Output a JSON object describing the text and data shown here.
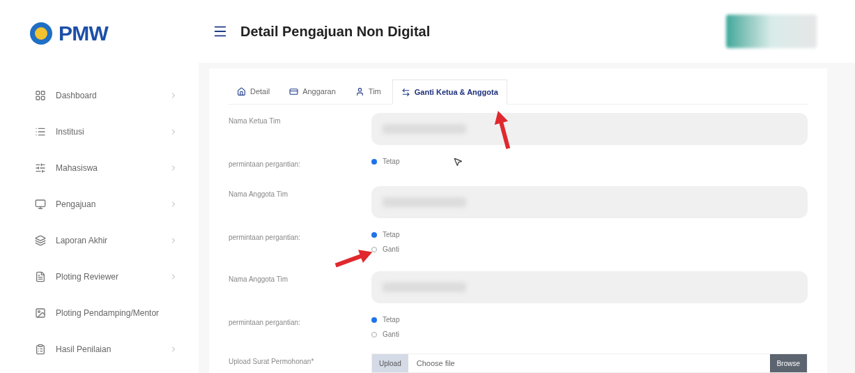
{
  "brand": {
    "text": "PMW"
  },
  "header": {
    "title": "Detail Pengajuan Non Digital"
  },
  "sidebar": {
    "items": [
      {
        "label": "Dashboard",
        "has_arrow": true
      },
      {
        "label": "Institusi",
        "has_arrow": true
      },
      {
        "label": "Mahasiswa",
        "has_arrow": true
      },
      {
        "label": "Pengajuan",
        "has_arrow": true
      },
      {
        "label": "Laporan Akhir",
        "has_arrow": true
      },
      {
        "label": "Ploting Reviewer",
        "has_arrow": true
      },
      {
        "label": "Ploting Pendamping/Mentor",
        "has_arrow": false
      },
      {
        "label": "Hasil Penilaian",
        "has_arrow": true
      }
    ]
  },
  "tabs": [
    {
      "label": "Detail",
      "selected": false
    },
    {
      "label": "Anggaran",
      "selected": false
    },
    {
      "label": "Tim",
      "selected": false
    },
    {
      "label": "Ganti Ketua & Anggota",
      "selected": true
    }
  ],
  "form": [
    {
      "kind": "field",
      "label": "Nama Ketua Tim"
    },
    {
      "kind": "radio",
      "label": "permintaan pergantian:",
      "options": [
        {
          "label": "Tetap",
          "selected": true
        }
      ]
    },
    {
      "kind": "field",
      "label": "Nama Anggota Tim"
    },
    {
      "kind": "radio",
      "label": "permintaan pergantian:",
      "options": [
        {
          "label": "Tetap",
          "selected": true
        },
        {
          "label": "Ganti",
          "selected": false
        }
      ]
    },
    {
      "kind": "field",
      "label": "Nama Anggota Tim"
    },
    {
      "kind": "radio",
      "label": "permintaan pergantian:",
      "options": [
        {
          "label": "Tetap",
          "selected": true
        },
        {
          "label": "Ganti",
          "selected": false
        }
      ]
    },
    {
      "kind": "upload",
      "label": "Upload Surat Permohonan*",
      "button": "Upload",
      "placeholder": "Choose file",
      "browse": "Browse"
    }
  ]
}
